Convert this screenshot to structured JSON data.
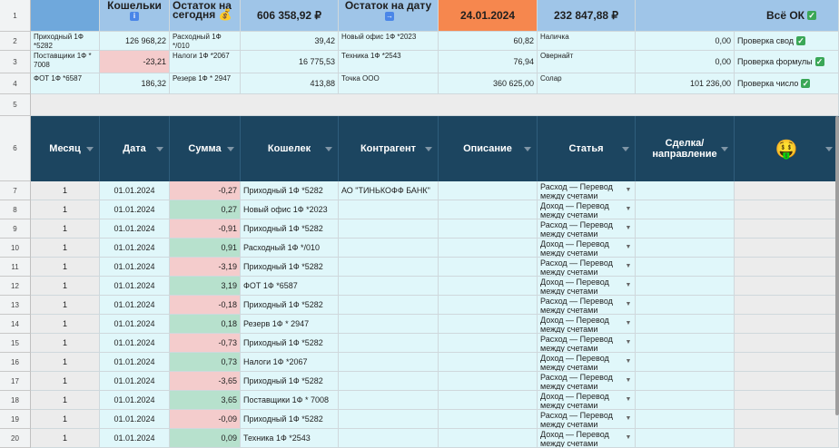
{
  "row_numbers": [
    "1",
    "2",
    "3",
    "4",
    "5",
    "6",
    "7",
    "8",
    "9",
    "10",
    "11",
    "12",
    "13",
    "14",
    "15",
    "16",
    "17",
    "18",
    "19",
    "20"
  ],
  "header": {
    "wallets_label": "Кошельки",
    "wallets_icon": "info-icon",
    "balance_today_label": "Остаток на сегодня",
    "balance_today_value": "606 358,92 ₽",
    "balance_date_label": "Остаток на дату",
    "balance_date_icon": "arrow-right-icon",
    "date_value": "24.01.2024",
    "balance_date_value": "232 847,88 ₽",
    "status_text": "Всё ОК",
    "status_icon": "checkmark-icon"
  },
  "balances": [
    [
      {
        "name": "Приходный 1Ф *5282",
        "value": "126 968,22",
        "highlight": false
      },
      {
        "name": "Расходный 1Ф */010",
        "value": "39,42"
      },
      {
        "name": "Новый офис 1Ф *2023",
        "value": "60,82"
      },
      {
        "name": "Наличка",
        "value": "0,00"
      },
      {
        "check": "Проверка свод"
      }
    ],
    [
      {
        "name": "Поставщики 1Ф * 7008",
        "value": "-23,21",
        "highlight": true
      },
      {
        "name": "Налоги 1Ф *2067",
        "value": "16 775,53"
      },
      {
        "name": "Техника 1Ф *2543",
        "value": "76,94"
      },
      {
        "name": "Овернайт",
        "value": "0,00"
      },
      {
        "check": "Проверка формулы"
      }
    ],
    [
      {
        "name": "ФОТ 1Ф *6587",
        "value": "186,32",
        "highlight": false
      },
      {
        "name": "Резерв 1Ф * 2947",
        "value": "413,88"
      },
      {
        "name": "Точка ООО",
        "value": "360 625,00"
      },
      {
        "name": "Солар",
        "value": "101 236,00"
      },
      {
        "check": "Проверка число"
      }
    ]
  ],
  "columns": [
    "Месяц",
    "Дата",
    "Сумма",
    "Кошелек",
    "Контрагент",
    "Описание",
    "Статья",
    "Сделка/ направление",
    ""
  ],
  "emoji_header_icon": "money-face-icon",
  "transactions": [
    {
      "month": "1",
      "date": "01.01.2024",
      "amount": "-0,27",
      "neg": true,
      "wallet": "Приходный 1Ф *5282",
      "counterparty": "АО \"ТИНЬКОФФ БАНК\"",
      "desc": "",
      "article": "Расход — Перевод между счетами"
    },
    {
      "month": "1",
      "date": "01.01.2024",
      "amount": "0,27",
      "neg": false,
      "wallet": "Новый офис 1Ф *2023",
      "counterparty": "",
      "desc": "",
      "article": "Доход — Перевод между счетами"
    },
    {
      "month": "1",
      "date": "01.01.2024",
      "amount": "-0,91",
      "neg": true,
      "wallet": "Приходный 1Ф *5282",
      "counterparty": "",
      "desc": "",
      "article": "Расход — Перевод между счетами"
    },
    {
      "month": "1",
      "date": "01.01.2024",
      "amount": "0,91",
      "neg": false,
      "wallet": "Расходный 1Ф */010",
      "counterparty": "",
      "desc": "",
      "article": "Доход — Перевод между счетами"
    },
    {
      "month": "1",
      "date": "01.01.2024",
      "amount": "-3,19",
      "neg": true,
      "wallet": "Приходный 1Ф *5282",
      "counterparty": "",
      "desc": "",
      "article": "Расход — Перевод между счетами"
    },
    {
      "month": "1",
      "date": "01.01.2024",
      "amount": "3,19",
      "neg": false,
      "wallet": "ФОТ 1Ф *6587",
      "counterparty": "",
      "desc": "",
      "article": "Доход — Перевод между счетами"
    },
    {
      "month": "1",
      "date": "01.01.2024",
      "amount": "-0,18",
      "neg": true,
      "wallet": "Приходный 1Ф *5282",
      "counterparty": "",
      "desc": "",
      "article": "Расход — Перевод между счетами"
    },
    {
      "month": "1",
      "date": "01.01.2024",
      "amount": "0,18",
      "neg": false,
      "wallet": "Резерв 1Ф * 2947",
      "counterparty": "",
      "desc": "",
      "article": "Доход — Перевод между счетами"
    },
    {
      "month": "1",
      "date": "01.01.2024",
      "amount": "-0,73",
      "neg": true,
      "wallet": "Приходный 1Ф *5282",
      "counterparty": "",
      "desc": "",
      "article": "Расход — Перевод между счетами"
    },
    {
      "month": "1",
      "date": "01.01.2024",
      "amount": "0,73",
      "neg": false,
      "wallet": "Налоги 1Ф *2067",
      "counterparty": "",
      "desc": "",
      "article": "Доход — Перевод между счетами"
    },
    {
      "month": "1",
      "date": "01.01.2024",
      "amount": "-3,65",
      "neg": true,
      "wallet": "Приходный 1Ф *5282",
      "counterparty": "",
      "desc": "",
      "article": "Расход — Перевод между счетами"
    },
    {
      "month": "1",
      "date": "01.01.2024",
      "amount": "3,65",
      "neg": false,
      "wallet": "Поставщики 1Ф * 7008",
      "counterparty": "",
      "desc": "",
      "article": "Доход — Перевод между счетами"
    },
    {
      "month": "1",
      "date": "01.01.2024",
      "amount": "-0,09",
      "neg": true,
      "wallet": "Приходный 1Ф *5282",
      "counterparty": "",
      "desc": "",
      "article": "Расход — Перевод между счетами"
    },
    {
      "month": "1",
      "date": "01.01.2024",
      "amount": "0,09",
      "neg": false,
      "wallet": "Техника 1Ф *2543",
      "counterparty": "",
      "desc": "",
      "article": "Доход — Перевод между счетами"
    }
  ],
  "colors": {
    "accent": "#6fa8dc",
    "header_dark": "#1c4560",
    "negative": "#f4cccc",
    "positive": "#b7e1cd",
    "date_cell": "#f6874e"
  }
}
